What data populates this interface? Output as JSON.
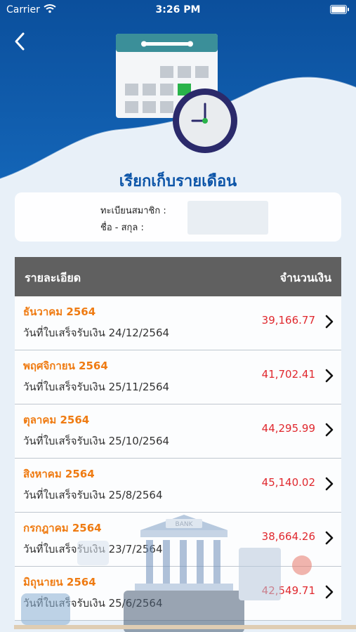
{
  "status": {
    "carrier": "Carrier",
    "time": "3:26 PM"
  },
  "header": {
    "title": "เรียกเก็บรายเดือน"
  },
  "member": {
    "reg_label": "ทะเบียนสมาชิก :",
    "name_label": "ชื่อ - สกุล :"
  },
  "table": {
    "col_detail": "รายละเอียด",
    "col_amount": "จำนวนเงิน",
    "rows": [
      {
        "month": "ธันวาคม 2564",
        "date": "วันที่ใบเสร็จรับเงิน 24/12/2564",
        "amount": "39,166.77"
      },
      {
        "month": "พฤศจิกายน 2564",
        "date": "วันที่ใบเสร็จรับเงิน 25/11/2564",
        "amount": "41,702.41"
      },
      {
        "month": "ตุลาคม 2564",
        "date": "วันที่ใบเสร็จรับเงิน 25/10/2564",
        "amount": "44,295.99"
      },
      {
        "month": "สิงหาคม 2564",
        "date": "วันที่ใบเสร็จรับเงิน 25/8/2564",
        "amount": "45,140.02"
      },
      {
        "month": "กรกฎาคม 2564",
        "date": "วันที่ใบเสร็จรับเงิน 23/7/2564",
        "amount": "38,664.26"
      },
      {
        "month": "มิถุนายน 2564",
        "date": "วันที่ใบเสร็จรับเงิน 25/6/2564",
        "amount": "42,549.71"
      }
    ]
  },
  "illustration": {
    "bank_sign": "BANK"
  },
  "colors": {
    "accent": "#0d55a8",
    "month": "#ef7b12",
    "amount": "#e0282e",
    "header": "#606060"
  }
}
